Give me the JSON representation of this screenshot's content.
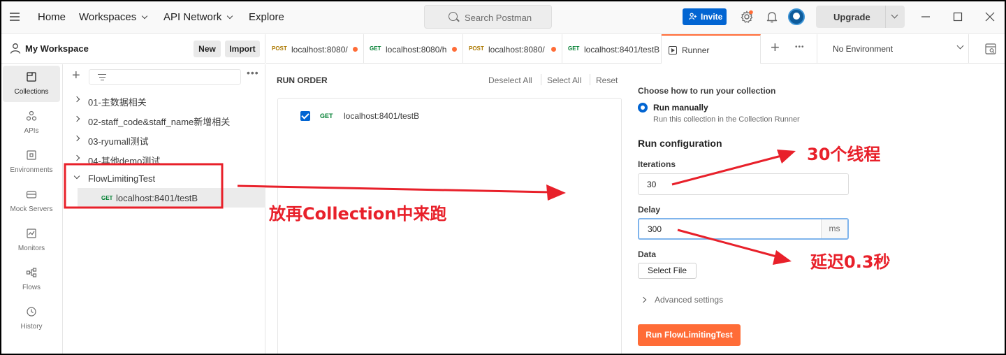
{
  "topbar": {
    "nav": [
      "Home",
      "Workspaces",
      "API Network",
      "Explore"
    ],
    "search_placeholder": "Search Postman",
    "invite_label": "Invite",
    "upgrade_label": "Upgrade"
  },
  "workspace": {
    "title": "My Workspace",
    "new_label": "New",
    "import_label": "Import"
  },
  "rail": [
    {
      "label": "Collections",
      "icon": "collections-icon"
    },
    {
      "label": "APIs",
      "icon": "apis-icon"
    },
    {
      "label": "Environments",
      "icon": "environments-icon"
    },
    {
      "label": "Mock Servers",
      "icon": "mock-servers-icon"
    },
    {
      "label": "Monitors",
      "icon": "monitors-icon"
    },
    {
      "label": "Flows",
      "icon": "flows-icon"
    },
    {
      "label": "History",
      "icon": "history-icon"
    }
  ],
  "tree": {
    "items": [
      {
        "label": "01-主数据相关"
      },
      {
        "label": "02-staff_code&staff_name新增相关"
      },
      {
        "label": "03-ryumall测试"
      },
      {
        "label": "04-其他demo测试"
      },
      {
        "label": "FlowLimitingTest"
      }
    ],
    "child": {
      "method": "GET",
      "label": "localhost:8401/testB"
    }
  },
  "tabs": [
    {
      "method": "POST",
      "label": "localhost:8080/"
    },
    {
      "method": "GET",
      "label": "localhost:8080/h"
    },
    {
      "method": "POST",
      "label": "localhost:8080/"
    },
    {
      "method": "GET",
      "label": "localhost:8401/testB"
    },
    {
      "label": "Runner"
    }
  ],
  "environment": "No Environment",
  "run_order": {
    "heading": "RUN ORDER",
    "deselect_all": "Deselect All",
    "select_all": "Select All",
    "reset": "Reset",
    "item": {
      "method": "GET",
      "url": "localhost:8401/testB",
      "checked": true
    }
  },
  "config": {
    "choose_heading": "Choose how to run your collection",
    "run_manually": "Run manually",
    "run_manually_sub": "Run this collection in the Collection Runner",
    "run_config": "Run configuration",
    "iterations_label": "Iterations",
    "iterations_value": "30",
    "delay_label": "Delay",
    "delay_value": "300",
    "delay_unit": "ms",
    "data_label": "Data",
    "select_file": "Select File",
    "advanced": "Advanced settings",
    "run_button": "Run FlowLimitingTest"
  },
  "annotations": {
    "collection_note": "放再Collection中来跑",
    "threads_note": "30个线程",
    "delay_note": "延迟0.3秒",
    "color": "#e8202a"
  }
}
